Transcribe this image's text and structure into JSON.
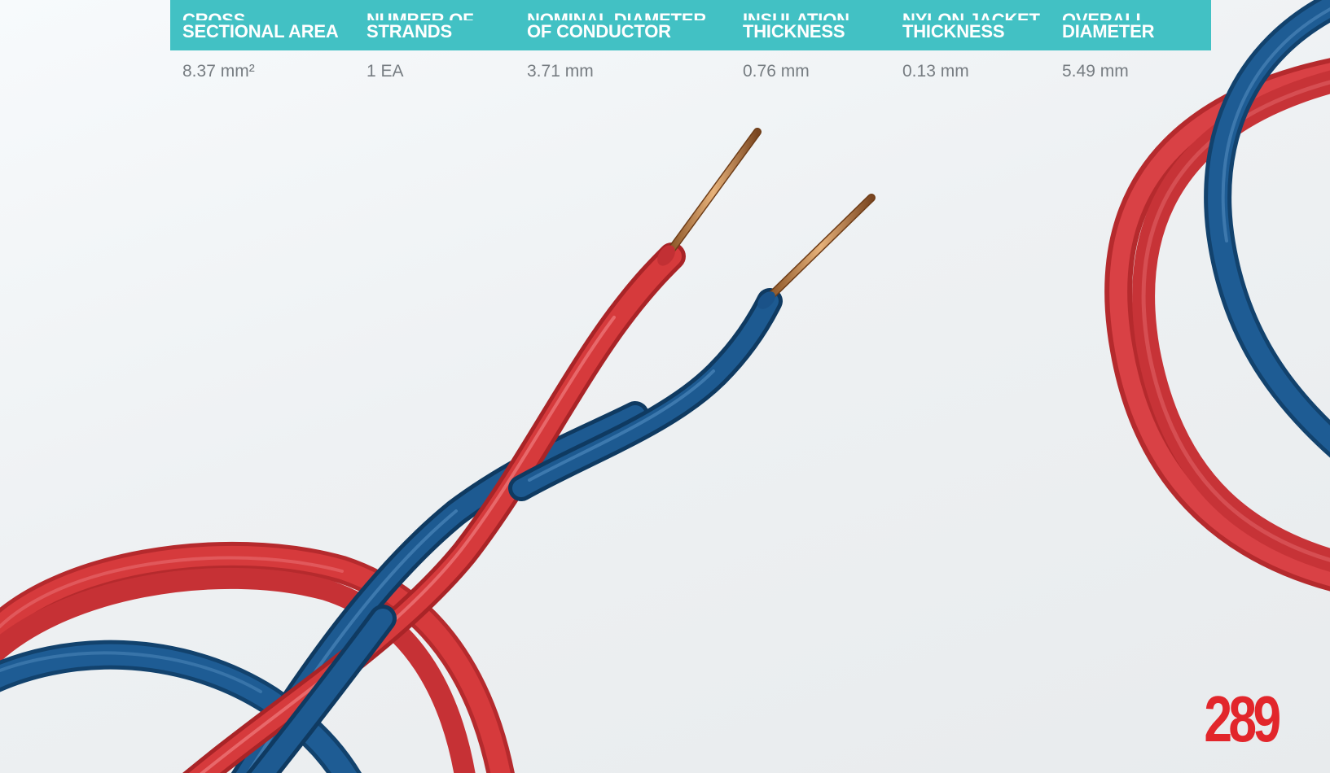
{
  "spec_table": {
    "headers": [
      {
        "line1": "CROSS",
        "line2": "SECTIONAL AREA"
      },
      {
        "line1": "NUMBER OF",
        "line2": "STRANDS"
      },
      {
        "line1": "NOMINAL DIAMETER",
        "line2": "OF CONDUCTOR"
      },
      {
        "line1": "INSULATION",
        "line2": "THICKNESS"
      },
      {
        "line1": "NYLON JACKET",
        "line2": "THICKNESS"
      },
      {
        "line1": "OVERALL",
        "line2": "DIAMETER"
      }
    ],
    "rows": [
      [
        "8.37 mm²",
        "1 EA",
        "3.71 mm",
        "0.76 mm",
        "0.13 mm",
        "5.49 mm"
      ]
    ]
  },
  "page_number": "289",
  "colors": {
    "header_bg": "#42c1c4",
    "header_text": "#ffffff",
    "cell_text": "#777d82",
    "page_number": "#e2262b",
    "wire_red": "#d63a3c",
    "wire_blue": "#1d5a91",
    "copper": "#c98a4a"
  }
}
